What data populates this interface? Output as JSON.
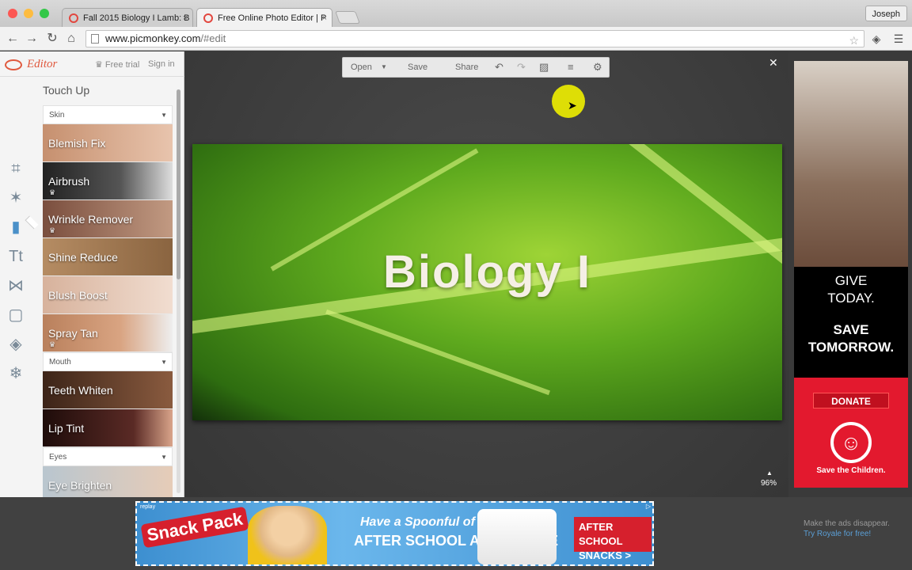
{
  "browser": {
    "tabs": [
      {
        "label": "Fall 2015 Biology I Lamb: B",
        "active": false
      },
      {
        "label": "Free Online Photo Editor | P",
        "active": true
      }
    ],
    "user": "Joseph",
    "url_host": "www.picmonkey.com",
    "url_path": "/#edit"
  },
  "sidebar": {
    "logo": "Editor",
    "free_trial": "Free trial",
    "sign_in": "Sign in",
    "section_title": "Touch Up",
    "tool_icons": [
      "crop-icon",
      "magic-wand-icon",
      "lipstick-icon",
      "text-icon",
      "butterfly-icon",
      "frame-icon",
      "texture-icon",
      "snowflake-icon"
    ],
    "groups": [
      {
        "category": "Skin",
        "items": [
          {
            "label": "Blemish Fix",
            "premium": false,
            "bg": "#d9a48a"
          },
          {
            "label": "Airbrush",
            "premium": true,
            "bg": "#2a2a2a"
          },
          {
            "label": "Wrinkle Remover",
            "premium": true,
            "bg": "#9c6a55"
          },
          {
            "label": "Shine Reduce",
            "premium": false,
            "bg": "#a07d5a"
          },
          {
            "label": "Blush Boost",
            "premium": false,
            "bg": "#e6c7b5"
          },
          {
            "label": "Spray Tan",
            "premium": true,
            "bg": "#c28d6a"
          }
        ]
      },
      {
        "category": "Mouth",
        "items": [
          {
            "label": "Teeth Whiten",
            "premium": false,
            "bg": "#5a3b2a"
          },
          {
            "label": "Lip Tint",
            "premium": false,
            "bg": "#3a1b1a"
          }
        ]
      },
      {
        "category": "Eyes",
        "items": [
          {
            "label": "Eye Brighten",
            "premium": false,
            "bg": "#9eb4c2"
          }
        ]
      }
    ]
  },
  "editor": {
    "open": "Open",
    "save": "Save",
    "share": "Share",
    "photo_title": "Biology I",
    "zoom": "96%"
  },
  "right_ad": {
    "line1": "GIVE",
    "line2": "TODAY.",
    "line3": "SAVE",
    "line4": "TOMORROW.",
    "donate": "DONATE",
    "org": "Save the Children."
  },
  "bottom_ad": {
    "replay": "replay",
    "brand": "Snack Pack",
    "tagline1": "Have a Spoonful of",
    "tagline2": "AFTER SCHOOL ADVENTURE",
    "cta": "AFTER SCHOOL SNACKS >"
  },
  "royale": {
    "note": "Make the ads disappear.",
    "link": "Try Royale for free!"
  },
  "colors": {
    "accent": "#e0593e",
    "active_tool": "#4a90c8",
    "ad_red": "#e3192e"
  }
}
